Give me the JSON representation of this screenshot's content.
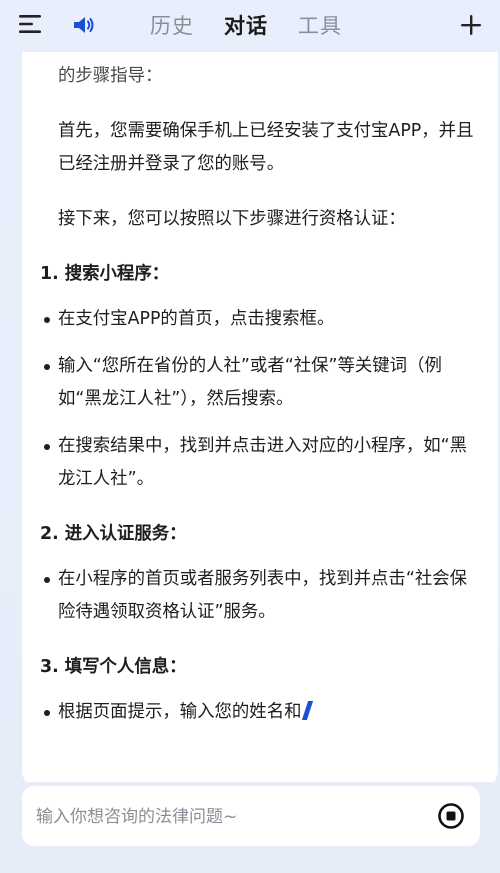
{
  "header": {
    "menu_icon": "hamburger-menu-icon",
    "speaker_icon": "speaker-volume-icon",
    "tabs": [
      {
        "label": "历史",
        "active": false
      },
      {
        "label": "对话",
        "active": true
      },
      {
        "label": "工具",
        "active": false
      }
    ],
    "plus_icon": "plus-icon",
    "accent_color": "#1b4fd6"
  },
  "message": {
    "intro_line": "认证，其实是一个相对简单且方便的过程。以下是详细的步骤指导：",
    "para_first": "首先，您需要确保手机上已经安装了支付宝APP，并且已经注册并登录了您的账号。",
    "para_next": "接下来，您可以按照以下步骤进行资格认证：",
    "steps": [
      {
        "title": "1. 搜索小程序：",
        "bullets": [
          "在支付宝APP的首页，点击搜索框。",
          "输入“您所在省份的人社”或者“社保”等关键词（例如“黑龙江人社”），然后搜索。",
          "在搜索结果中，找到并点击进入对应的小程序，如“黑龙江人社”。"
        ]
      },
      {
        "title": "2. 进入认证服务：",
        "bullets": [
          "在小程序的首页或者服务列表中，找到并点击“社会保险待遇领取资格认证”服务。"
        ]
      },
      {
        "title": "3. 填写个人信息：",
        "bullets": [
          "根据页面提示，输入您的姓名和"
        ]
      }
    ]
  },
  "input": {
    "placeholder": "输入你想咨询的法律问题~",
    "value": "",
    "stop_icon": "stop-generating-icon"
  }
}
